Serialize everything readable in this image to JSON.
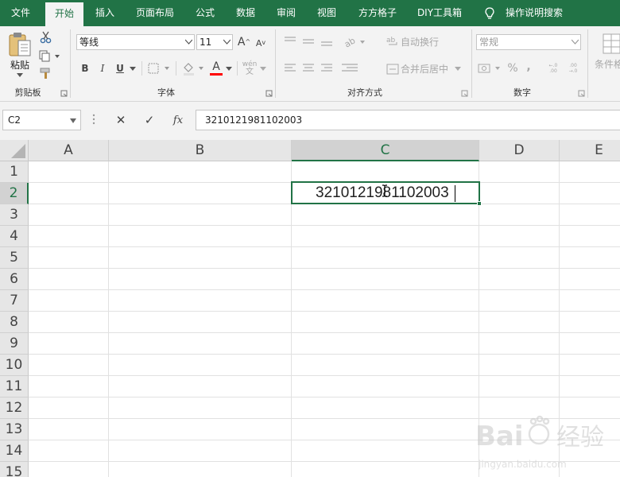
{
  "menu": {
    "tabs": [
      {
        "label": "文件",
        "active": false
      },
      {
        "label": "开始",
        "active": true
      },
      {
        "label": "插入",
        "active": false
      },
      {
        "label": "页面布局",
        "active": false
      },
      {
        "label": "公式",
        "active": false
      },
      {
        "label": "数据",
        "active": false
      },
      {
        "label": "审阅",
        "active": false
      },
      {
        "label": "视图",
        "active": false
      },
      {
        "label": "方方格子",
        "active": false
      },
      {
        "label": "DIY工具箱",
        "active": false
      }
    ],
    "tell_me": "操作说明搜索",
    "accent_color": "#217346"
  },
  "ribbon": {
    "clipboard": {
      "paste_label": "粘贴",
      "group_label": "剪贴板"
    },
    "font": {
      "font_name": "等线",
      "font_size": "11",
      "grow_label": "A",
      "shrink_label": "A",
      "bold_label": "B",
      "italic_label": "I",
      "underline_label": "U",
      "font_color_label": "A",
      "font_color": "#ff0000",
      "phonetic_label": "wén",
      "group_label": "字体"
    },
    "alignment": {
      "wrap_text": "自动换行",
      "merge_center": "合并后居中",
      "group_label": "对齐方式"
    },
    "number": {
      "format": "常规",
      "percent": "%",
      "comma": ",",
      "inc_decimal": "←.0 .00",
      "dec_decimal": ".00 →.0",
      "group_label": "数字"
    },
    "styles": {
      "conditional_format": "条件格"
    }
  },
  "formula_bar": {
    "name_box": "C2",
    "cancel": "✕",
    "enter": "✓",
    "fx": "fx",
    "content": "3210121981102003"
  },
  "sheet": {
    "columns": [
      "A",
      "B",
      "C",
      "D",
      "E"
    ],
    "rows": [
      "1",
      "2",
      "3",
      "4",
      "5",
      "6",
      "7",
      "8",
      "9",
      "10",
      "11",
      "12",
      "13",
      "14",
      "15"
    ],
    "selected_column": "C",
    "selected_row": "2",
    "active_cell": "C2",
    "active_cell_value": "3210121981102003"
  }
}
